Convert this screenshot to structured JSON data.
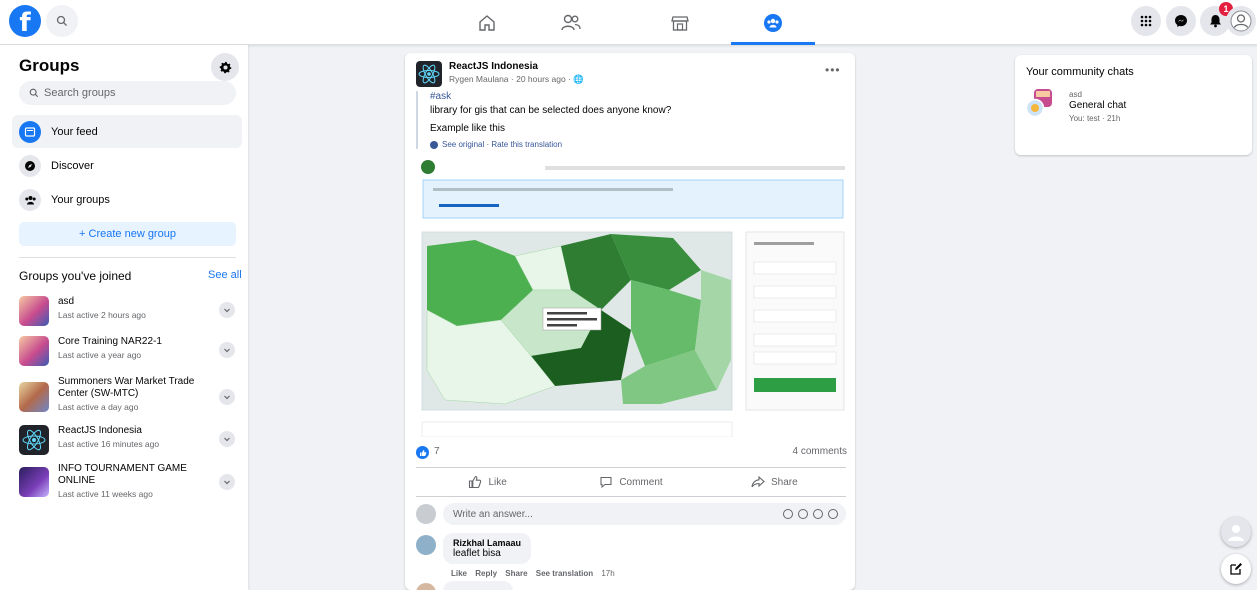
{
  "sidebar": {
    "title": "Groups",
    "search_placeholder": "Search groups",
    "nav": [
      {
        "label": "Your feed"
      },
      {
        "label": "Discover"
      },
      {
        "label": "Your groups"
      }
    ],
    "create_label": "+ Create new group",
    "joined_title": "Groups you've joined",
    "see_all": "See all",
    "groups": [
      {
        "name": "asd",
        "activity": "Last active 2 hours ago"
      },
      {
        "name": "Core Training NAR22-1",
        "activity": "Last active a year ago"
      },
      {
        "name": "Summoners War Market Trade Center (SW-MTC)",
        "activity": "Last active a day ago"
      },
      {
        "name": "ReactJS Indonesia",
        "activity": "Last active 16 minutes ago"
      },
      {
        "name": "INFO TOURNAMENT GAME ONLINE",
        "activity": "Last active 11 weeks ago"
      }
    ]
  },
  "topbar": {
    "notification_count": "1"
  },
  "post": {
    "group": "ReactJS Indonesia",
    "meta": "Rygen Maulana · 20 hours ago · 🌐",
    "tag": "#ask",
    "text": "library for gis that can be selected does anyone know?",
    "text2": "Example like this",
    "translate": "See original · Rate this translation",
    "like_count": "7",
    "comment_count": "4 comments",
    "actions": {
      "like": "Like",
      "comment": "Comment",
      "share": "Share"
    },
    "answer_placeholder": "Write an answer...",
    "comments": [
      {
        "author": "Rizkhal Lamaau",
        "text": "leaflet bisa",
        "actions": [
          "Like",
          "Reply",
          "Share",
          "See translation"
        ],
        "time": "17h"
      }
    ]
  },
  "chats": {
    "title": "Your community chats",
    "items": [
      {
        "group": "asd",
        "name": "General chat",
        "last": "You: test · 21h"
      }
    ]
  },
  "colors": {
    "brand": "#1877f2",
    "badge": "#e41e3f"
  }
}
